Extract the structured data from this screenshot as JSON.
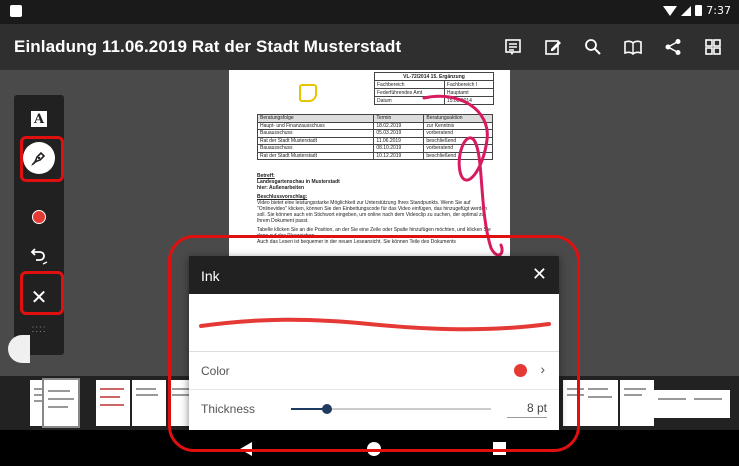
{
  "status": {
    "time": "7:37"
  },
  "appbar": {
    "title": "Einladung 11.06.2019 Rat der Stadt Musterstadt",
    "actions": [
      "annotation-list-icon",
      "edit-icon",
      "search-icon",
      "book-icon",
      "share-icon",
      "grid-icon"
    ]
  },
  "document": {
    "info_table": {
      "header": "VL-72/2014 15. Ergänzung",
      "rows": [
        [
          "Fachbereich",
          "Fachbereich I"
        ],
        [
          "Federführendes Amt",
          "Hauptamt"
        ],
        [
          "Datum",
          "15.05.2014"
        ]
      ]
    },
    "schedule": {
      "headers": [
        "Beratungsfolge",
        "Termin",
        "Beratungsaktion"
      ],
      "rows": [
        [
          "Haupt- und Finanzausschuss",
          "18.02.2019",
          "zur Kenntnis"
        ],
        [
          "Bauausschuss",
          "05.03.2019",
          "vorberatend"
        ],
        [
          "Rat der Stadt Musterstadt",
          "11.06.2019",
          "beschließend"
        ],
        [
          "Bauausschuss",
          "08.10.2019",
          "vorberatend"
        ],
        [
          "Rat der Stadt Musterstadt",
          "10.12.2019",
          "beschließend"
        ]
      ]
    },
    "betreff_label": "Betreff:",
    "betreff_line1": "Landesgartenschau in Musterstadt",
    "betreff_line2": "hier: Außenarbeiten",
    "beschluss_label": "Beschlussvorschlag:",
    "para1": "Video bietet eine leistungsstarke Möglichkeit zur Unterstützung Ihres Standpunkts. Wenn Sie auf \"Onlinevideo\" klicken, können Sie den Einbettungscode für das Video einfügen, das hinzugefügt werden soll. Sie können auch ein Stichwort eingeben, um online nach dem Videoclip zu suchen, der optimal zu Ihrem Dokument passt.",
    "para2": "Tabelle klicken Sie an die Position, an der Sie eine Zeile oder Spalte hinzufügen möchten, und klicken Sie dann auf das Pluszeichen.",
    "para3": "Auch das Lesen ist bequemer in der neuen Leseansicht. Sie können Teile des Dokuments"
  },
  "toolbar": {
    "text_tool_glyph": "A",
    "close_glyph": "✕",
    "handle_glyph": "::::",
    "ink_color": "#e53935"
  },
  "ink_popup": {
    "title": "Ink",
    "close_glyph": "✕",
    "color_label": "Color",
    "color_value": "#e53935",
    "chevron": "›",
    "thickness_label": "Thickness",
    "thickness_value": "8 pt",
    "thickness_fraction": 0.18
  }
}
